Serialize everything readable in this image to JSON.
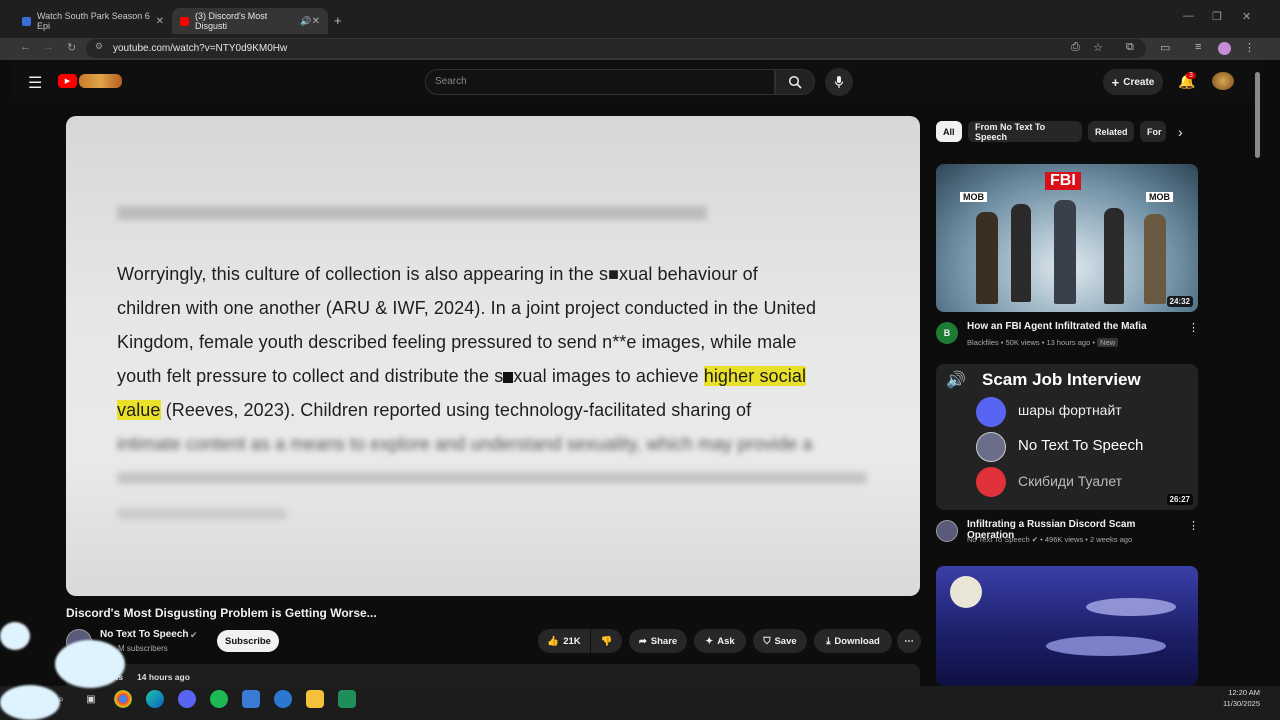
{
  "browser": {
    "tabs": [
      {
        "label": "Watch South Park Season 6 Epi"
      },
      {
        "label": "(3) Discord's Most Disgusti"
      }
    ],
    "url": "youtube.com/watch?v=NTY0d9KM0Hw"
  },
  "youtube": {
    "search_placeholder": "Search",
    "create_label": "Create",
    "notification_count": "3"
  },
  "video": {
    "lines": [
      "Worryingly, this culture of collection is also appearing in the s■xual behaviour of",
      "children with one another (ARU & IWF, 2024). In a joint project conducted in the United",
      "Kingdom, female youth described feeling pressured to send n**e images, while male"
    ],
    "line4_pre": "youth felt pressure to collect and distribute the s",
    "line4_post": "xual images to achieve ",
    "line4_highlight": "higher social",
    "line5_highlight": "value",
    "line5_rest": " (Reeves, 2023). Children reported using technology-facilitated sharing of",
    "blurred_line": "intimate content as a means to explore and understand sexuality, which may provide a"
  },
  "below": {
    "title": "Discord's Most Disgusting Problem is Getting Worse...",
    "channel": "No Text To Speech",
    "subscribers": "M subscribers",
    "subscribe_label": "Subscribe",
    "likes": "21K",
    "share_label": "Share",
    "ask_label": "Ask",
    "save_label": "Save",
    "download_label": "Download",
    "views": "views",
    "age": "14 hours ago"
  },
  "chips": [
    "All",
    "From No Text To Speech",
    "Related",
    "For"
  ],
  "recommendations": [
    {
      "title": "How an FBI Agent Infiltrated the Mafia",
      "channel": "Blackfiles",
      "meta": "50K views • 13 hours ago",
      "badge": "New",
      "duration": "24:32",
      "thumb_label": "FBI",
      "mob_label": "MOB"
    },
    {
      "title": "Infiltrating a Russian Discord Scam Operation",
      "channel": "No Text To Speech",
      "meta": "496K views • 2 weeks ago",
      "duration": "26:27",
      "thumb_heading": "Scam Job Interview",
      "thumb_rows": [
        "шары фортнайт",
        "No Text To Speech",
        "Скибиди Туалет"
      ]
    }
  ],
  "clock": {
    "time": "12:20 AM",
    "date": "11/30/2025"
  },
  "colors": {
    "accent_red": "#ff0000",
    "highlight": "#e9e02a"
  }
}
